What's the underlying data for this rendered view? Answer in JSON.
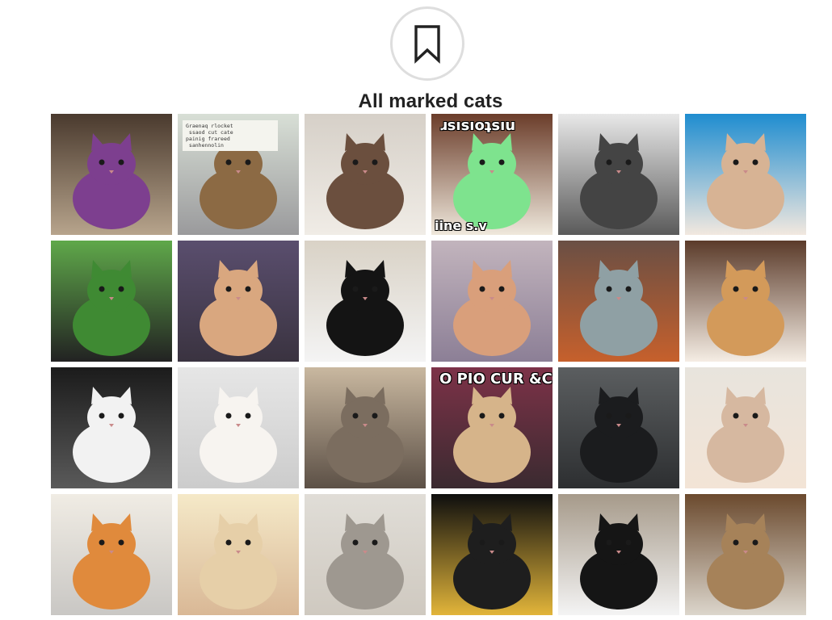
{
  "page": {
    "title": "All marked cats",
    "header_icon": "bookmark-icon"
  },
  "colors": {
    "background": "#ffffff",
    "icon_circle_border": "#dedede",
    "icon_stroke": "#222222",
    "title_text": "#222222"
  },
  "grid": {
    "columns": 6,
    "rows": 4
  },
  "cats": [
    {
      "name": "purple-lump-cat",
      "colors": [
        "#4a3a2e",
        "#7d3f8f",
        "#b7a48c"
      ],
      "caption": ""
    },
    {
      "name": "tabby-on-couch-with-sign",
      "colors": [
        "#d8dfd6",
        "#8c6a44",
        "#9a9a9c"
      ],
      "caption": "",
      "sign_text": "Graenaq rlocket\n ssaod cut cate\npainig frareed\n sanhennolin"
    },
    {
      "name": "brown-white-curled-cat",
      "colors": [
        "#d6d0c8",
        "#6b4f3e",
        "#f0ece6"
      ],
      "caption": ""
    },
    {
      "name": "meme-kitten",
      "colors": [
        "#6b3d2a",
        "#7ee38e",
        "#efe8dc"
      ],
      "caption_top": "ɹsısıoʇsıu",
      "caption_bottom": "iine s.v"
    },
    {
      "name": "gray-white-cat-on-rug",
      "colors": [
        "#e8e8e8",
        "#444444",
        "#5a5a5a"
      ],
      "caption": ""
    },
    {
      "name": "fluffy-cream-cat-blue",
      "colors": [
        "#1f8dd0",
        "#d7b394",
        "#f2e8df"
      ],
      "caption": ""
    },
    {
      "name": "tiny-cat-in-grass",
      "colors": [
        "#5fa84a",
        "#3f8a33",
        "#222222"
      ],
      "caption": ""
    },
    {
      "name": "man-with-cats-on-sofa",
      "colors": [
        "#5a4e6e",
        "#d9a77f",
        "#3a3340"
      ],
      "caption": ""
    },
    {
      "name": "black-white-kitten",
      "colors": [
        "#d9d2c6",
        "#141414",
        "#f4f4f4"
      ],
      "caption": ""
    },
    {
      "name": "orange-kitten-blanket",
      "colors": [
        "#c2b4bd",
        "#d99f7b",
        "#8c7f96"
      ],
      "caption": ""
    },
    {
      "name": "gray-tabby-in-box",
      "colors": [
        "#6a4f44",
        "#8fa0a4",
        "#c6602c"
      ],
      "caption": ""
    },
    {
      "name": "orange-tabby-frowning",
      "colors": [
        "#5b3b2a",
        "#d39a5a",
        "#f5ede4"
      ],
      "caption": ""
    },
    {
      "name": "black-white-longhair",
      "colors": [
        "#1b1b1b",
        "#f2f2f2",
        "#5a5a5a"
      ],
      "caption": ""
    },
    {
      "name": "white-fluffy-kitten",
      "colors": [
        "#e6e6e6",
        "#f7f4f0",
        "#cccccc"
      ],
      "caption": ""
    },
    {
      "name": "tabby-lying-on-carpet",
      "colors": [
        "#c9b8a0",
        "#7b6d5f",
        "#5c5046"
      ],
      "caption": ""
    },
    {
      "name": "grumpy-cat-meme",
      "colors": [
        "#7d3248",
        "#d6b48a",
        "#3a2a30"
      ],
      "caption_top": "O PIO CUR &C"
    },
    {
      "name": "black-cat-on-sofa",
      "colors": [
        "#5b5e60",
        "#1b1c1e",
        "#2d2f31"
      ],
      "caption": ""
    },
    {
      "name": "cream-kitten-blue-eyes",
      "colors": [
        "#e8e4dd",
        "#d6b8a0",
        "#f3e4d6"
      ],
      "caption": ""
    },
    {
      "name": "orange-kitten-closeup",
      "colors": [
        "#f0ece4",
        "#e08a3c",
        "#c9c7c4"
      ],
      "caption": ""
    },
    {
      "name": "cream-kitten-yellow",
      "colors": [
        "#f5e9c8",
        "#e6cfa8",
        "#d9b896"
      ],
      "caption": ""
    },
    {
      "name": "silver-tabby-kitten",
      "colors": [
        "#e0ddd7",
        "#9e9890",
        "#cfc9c0"
      ],
      "caption": ""
    },
    {
      "name": "black-cat-yellow-eyes",
      "colors": [
        "#0e0e0e",
        "#1e1e1e",
        "#e2b53a"
      ],
      "caption": ""
    },
    {
      "name": "tuxedo-cat-sitting",
      "colors": [
        "#a69a8a",
        "#151515",
        "#f4f4f4"
      ],
      "caption": ""
    },
    {
      "name": "surreal-cat-room",
      "colors": [
        "#6b4a2e",
        "#a68259",
        "#dcd6cc"
      ],
      "caption": ""
    }
  ]
}
